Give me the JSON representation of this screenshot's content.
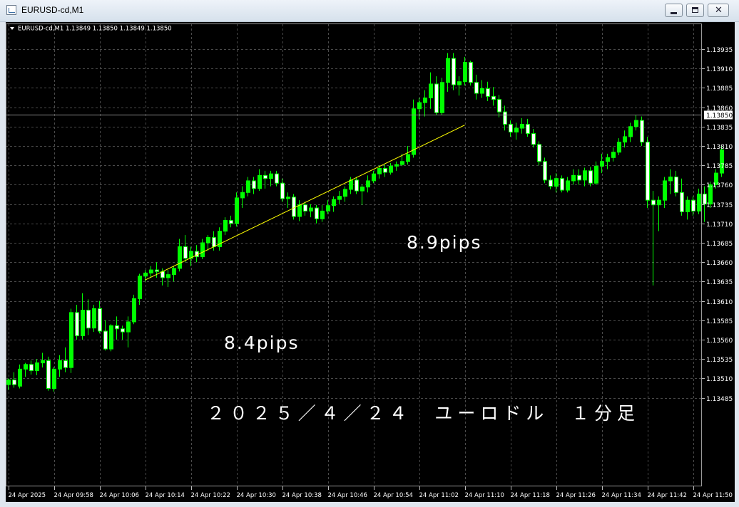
{
  "window": {
    "title": "EURUSD-cd,M1",
    "buttons": [
      "minimize",
      "maximize",
      "close"
    ],
    "close_glyph": "✕"
  },
  "chart_info": "EURUSD-cd,M1  1.13849 1.13850 1.13849 1.13850",
  "colors": {
    "background": "#000000",
    "grid": "#4a4a4a",
    "bull_candle": "#00ff00",
    "bear_candle": "#ffffff",
    "trendline": "#ffff00",
    "annotation_text": "#ffffff"
  },
  "annotations": {
    "pips_1": "8.4pips",
    "pips_2": "8.9pips",
    "caption": "２０２５／４／２４　ユーロドル　１分足"
  },
  "chart_data": {
    "type": "candlestick",
    "symbol": "EURUSD-cd",
    "timeframe": "M1",
    "ohlc_header": {
      "open": 1.13849,
      "high": 1.1385,
      "low": 1.13849,
      "close": 1.1385
    },
    "current_price": "1.13850",
    "grid": true,
    "y_ticks": [
      "1.13935",
      "1.13910",
      "1.13885",
      "1.13860",
      "1.13835",
      "1.13810",
      "1.13785",
      "1.13760",
      "1.13735",
      "1.13710",
      "1.13685",
      "1.13660",
      "1.13635",
      "1.13610",
      "1.13585",
      "1.13560",
      "1.13535",
      "1.13510",
      "1.13485"
    ],
    "x_ticks": [
      "24 Apr 2025",
      "24 Apr 09:58",
      "24 Apr 10:06",
      "24 Apr 10:14",
      "24 Apr 10:22",
      "24 Apr 10:30",
      "24 Apr 10:38",
      "24 Apr 10:46",
      "24 Apr 10:54",
      "24 Apr 11:02",
      "24 Apr 11:10",
      "24 Apr 11:18",
      "24 Apr 11:26",
      "24 Apr 11:34",
      "24 Apr 11:42",
      "24 Apr 11:50"
    ],
    "trendlines": [
      {
        "from_time": "24 Apr 10:14",
        "from_price": 1.13637,
        "to_time": "24 Apr 11:10",
        "to_price": 1.13837
      }
    ],
    "candles": [
      [
        1.13502,
        1.1351,
        1.13495,
        1.13508
      ],
      [
        1.13508,
        1.13518,
        1.13498,
        1.13502
      ],
      [
        1.135,
        1.13528,
        1.13497,
        1.13522
      ],
      [
        1.13522,
        1.1353,
        1.13512,
        1.13528
      ],
      [
        1.13528,
        1.13533,
        1.13515,
        1.1352
      ],
      [
        1.1352,
        1.13535,
        1.13514,
        1.1353
      ],
      [
        1.1353,
        1.13543,
        1.13524,
        1.13533
      ],
      [
        1.13533,
        1.13538,
        1.13494,
        1.13497
      ],
      [
        1.13497,
        1.13525,
        1.13493,
        1.13522
      ],
      [
        1.13522,
        1.1354,
        1.13512,
        1.13533
      ],
      [
        1.13533,
        1.1355,
        1.13518,
        1.13524
      ],
      [
        1.13524,
        1.136,
        1.13517,
        1.13595
      ],
      [
        1.13595,
        1.13605,
        1.1356,
        1.13565
      ],
      [
        1.13565,
        1.1362,
        1.1356,
        1.13598
      ],
      [
        1.13598,
        1.13612,
        1.13566,
        1.13575
      ],
      [
        1.13575,
        1.13605,
        1.1357,
        1.136
      ],
      [
        1.136,
        1.1361,
        1.13568,
        1.13571
      ],
      [
        1.13571,
        1.13585,
        1.13546,
        1.13548
      ],
      [
        1.13548,
        1.1358,
        1.13545,
        1.13578
      ],
      [
        1.13578,
        1.1359,
        1.1356,
        1.13574
      ],
      [
        1.13574,
        1.13578,
        1.1356,
        1.1357
      ],
      [
        1.1357,
        1.1359,
        1.1355,
        1.13583
      ],
      [
        1.13583,
        1.13618,
        1.1358,
        1.13613
      ],
      [
        1.13613,
        1.13645,
        1.13605,
        1.13642
      ],
      [
        1.13642,
        1.1365,
        1.13635,
        1.13646
      ],
      [
        1.13646,
        1.13655,
        1.1364,
        1.1365
      ],
      [
        1.1365,
        1.1366,
        1.1364,
        1.13648
      ],
      [
        1.13648,
        1.13652,
        1.1363,
        1.1364
      ],
      [
        1.1364,
        1.1365,
        1.13628,
        1.13644
      ],
      [
        1.13644,
        1.13655,
        1.13635,
        1.13652
      ],
      [
        1.13652,
        1.1369,
        1.13648,
        1.1368
      ],
      [
        1.1368,
        1.13695,
        1.1366,
        1.13665
      ],
      [
        1.13665,
        1.1368,
        1.13655,
        1.13674
      ],
      [
        1.13674,
        1.13682,
        1.1366,
        1.13667
      ],
      [
        1.13667,
        1.1369,
        1.13664,
        1.13685
      ],
      [
        1.13685,
        1.13695,
        1.13675,
        1.13692
      ],
      [
        1.13692,
        1.137,
        1.13675,
        1.1368
      ],
      [
        1.1368,
        1.13705,
        1.13675,
        1.137
      ],
      [
        1.137,
        1.13718,
        1.13695,
        1.13714
      ],
      [
        1.13714,
        1.1372,
        1.13705,
        1.1371
      ],
      [
        1.1371,
        1.1375,
        1.13706,
        1.13743
      ],
      [
        1.13743,
        1.13758,
        1.1373,
        1.1375
      ],
      [
        1.1375,
        1.1377,
        1.13745,
        1.13765
      ],
      [
        1.13765,
        1.1377,
        1.13748,
        1.13755
      ],
      [
        1.13755,
        1.1378,
        1.13752,
        1.13772
      ],
      [
        1.13772,
        1.13778,
        1.13755,
        1.13768
      ],
      [
        1.13768,
        1.13778,
        1.13758,
        1.13774
      ],
      [
        1.13774,
        1.13778,
        1.13758,
        1.13762
      ],
      [
        1.13762,
        1.13768,
        1.13738,
        1.13742
      ],
      [
        1.13742,
        1.1375,
        1.1373,
        1.13744
      ],
      [
        1.13744,
        1.13748,
        1.13715,
        1.13719
      ],
      [
        1.13719,
        1.1374,
        1.13713,
        1.13734
      ],
      [
        1.13734,
        1.13738,
        1.1372,
        1.13726
      ],
      [
        1.13726,
        1.13735,
        1.13718,
        1.1373
      ],
      [
        1.1373,
        1.13734,
        1.1371,
        1.13716
      ],
      [
        1.13716,
        1.13734,
        1.13712,
        1.13726
      ],
      [
        1.13726,
        1.1374,
        1.13722,
        1.13733
      ],
      [
        1.13733,
        1.13745,
        1.13725,
        1.13741
      ],
      [
        1.13741,
        1.13752,
        1.13735,
        1.13745
      ],
      [
        1.13745,
        1.13758,
        1.13738,
        1.13754
      ],
      [
        1.13754,
        1.1377,
        1.13748,
        1.13766
      ],
      [
        1.13766,
        1.1377,
        1.13748,
        1.13752
      ],
      [
        1.13752,
        1.1376,
        1.13734,
        1.13757
      ],
      [
        1.13757,
        1.13772,
        1.1375,
        1.13765
      ],
      [
        1.13765,
        1.13778,
        1.13762,
        1.13774
      ],
      [
        1.13774,
        1.13785,
        1.13768,
        1.13781
      ],
      [
        1.13781,
        1.13786,
        1.1377,
        1.13776
      ],
      [
        1.13776,
        1.13788,
        1.13773,
        1.13784
      ],
      [
        1.13784,
        1.1379,
        1.13778,
        1.13786
      ],
      [
        1.13786,
        1.138,
        1.13784,
        1.1379
      ],
      [
        1.1379,
        1.1381,
        1.13786,
        1.13799
      ],
      [
        1.13799,
        1.1387,
        1.13795,
        1.13858
      ],
      [
        1.13858,
        1.13872,
        1.13845,
        1.13866
      ],
      [
        1.13866,
        1.13882,
        1.13848,
        1.13872
      ],
      [
        1.13872,
        1.13905,
        1.13858,
        1.1389
      ],
      [
        1.1389,
        1.139,
        1.1385,
        1.13853
      ],
      [
        1.13853,
        1.13898,
        1.1385,
        1.13892
      ],
      [
        1.13892,
        1.1393,
        1.1388,
        1.13923
      ],
      [
        1.13923,
        1.1393,
        1.13882,
        1.13889
      ],
      [
        1.13889,
        1.139,
        1.13875,
        1.13893
      ],
      [
        1.13893,
        1.13925,
        1.13888,
        1.13918
      ],
      [
        1.13918,
        1.1392,
        1.13888,
        1.13892
      ],
      [
        1.13892,
        1.13902,
        1.1387,
        1.13878
      ],
      [
        1.13878,
        1.13895,
        1.13872,
        1.13884
      ],
      [
        1.13884,
        1.13893,
        1.13868,
        1.13874
      ],
      [
        1.13874,
        1.13886,
        1.13862,
        1.1387
      ],
      [
        1.1387,
        1.13876,
        1.13847,
        1.13854
      ],
      [
        1.13854,
        1.13862,
        1.1383,
        1.13838
      ],
      [
        1.13838,
        1.13843,
        1.13822,
        1.13828
      ],
      [
        1.13828,
        1.1384,
        1.13818,
        1.13833
      ],
      [
        1.13833,
        1.13846,
        1.13826,
        1.13838
      ],
      [
        1.13838,
        1.13845,
        1.13822,
        1.13826
      ],
      [
        1.13826,
        1.13832,
        1.13808,
        1.13812
      ],
      [
        1.13812,
        1.13816,
        1.13785,
        1.1379
      ],
      [
        1.1379,
        1.13795,
        1.13762,
        1.13766
      ],
      [
        1.13766,
        1.13772,
        1.13754,
        1.13758
      ],
      [
        1.13758,
        1.13775,
        1.1375,
        1.13768
      ],
      [
        1.13768,
        1.13772,
        1.1375,
        1.13753
      ],
      [
        1.13753,
        1.1377,
        1.1375,
        1.13765
      ],
      [
        1.13765,
        1.1378,
        1.1376,
        1.13772
      ],
      [
        1.13772,
        1.1378,
        1.1376,
        1.13766
      ],
      [
        1.13766,
        1.13782,
        1.13758,
        1.13778
      ],
      [
        1.13778,
        1.13783,
        1.13758,
        1.13762
      ],
      [
        1.13762,
        1.1379,
        1.1376,
        1.13784
      ],
      [
        1.13784,
        1.138,
        1.13775,
        1.1379
      ],
      [
        1.1379,
        1.138,
        1.1378,
        1.13795
      ],
      [
        1.13795,
        1.13808,
        1.1379,
        1.13802
      ],
      [
        1.13802,
        1.1382,
        1.13798,
        1.13815
      ],
      [
        1.13815,
        1.1383,
        1.13808,
        1.13822
      ],
      [
        1.13822,
        1.1384,
        1.13815,
        1.13835
      ],
      [
        1.13835,
        1.1385,
        1.1383,
        1.13843
      ],
      [
        1.13843,
        1.13848,
        1.1381,
        1.13815
      ],
      [
        1.13815,
        1.13822,
        1.1373,
        1.1374
      ],
      [
        1.1374,
        1.13752,
        1.1363,
        1.13734
      ],
      [
        1.13734,
        1.13745,
        1.137,
        1.1374
      ],
      [
        1.1374,
        1.1377,
        1.1373,
        1.13765
      ],
      [
        1.13765,
        1.1378,
        1.13748,
        1.1377
      ],
      [
        1.1377,
        1.13778,
        1.13745,
        1.1375
      ],
      [
        1.1375,
        1.13768,
        1.1372,
        1.13725
      ],
      [
        1.13725,
        1.13745,
        1.13715,
        1.1374
      ],
      [
        1.1374,
        1.13745,
        1.1372,
        1.13726
      ],
      [
        1.13726,
        1.13755,
        1.13722,
        1.13748
      ],
      [
        1.13748,
        1.13758,
        1.13712,
        1.13735
      ],
      [
        1.13735,
        1.13764,
        1.1373,
        1.1376
      ],
      [
        1.1376,
        1.1378,
        1.13755,
        1.13775
      ],
      [
        1.13775,
        1.1381,
        1.1377,
        1.13805
      ]
    ]
  }
}
